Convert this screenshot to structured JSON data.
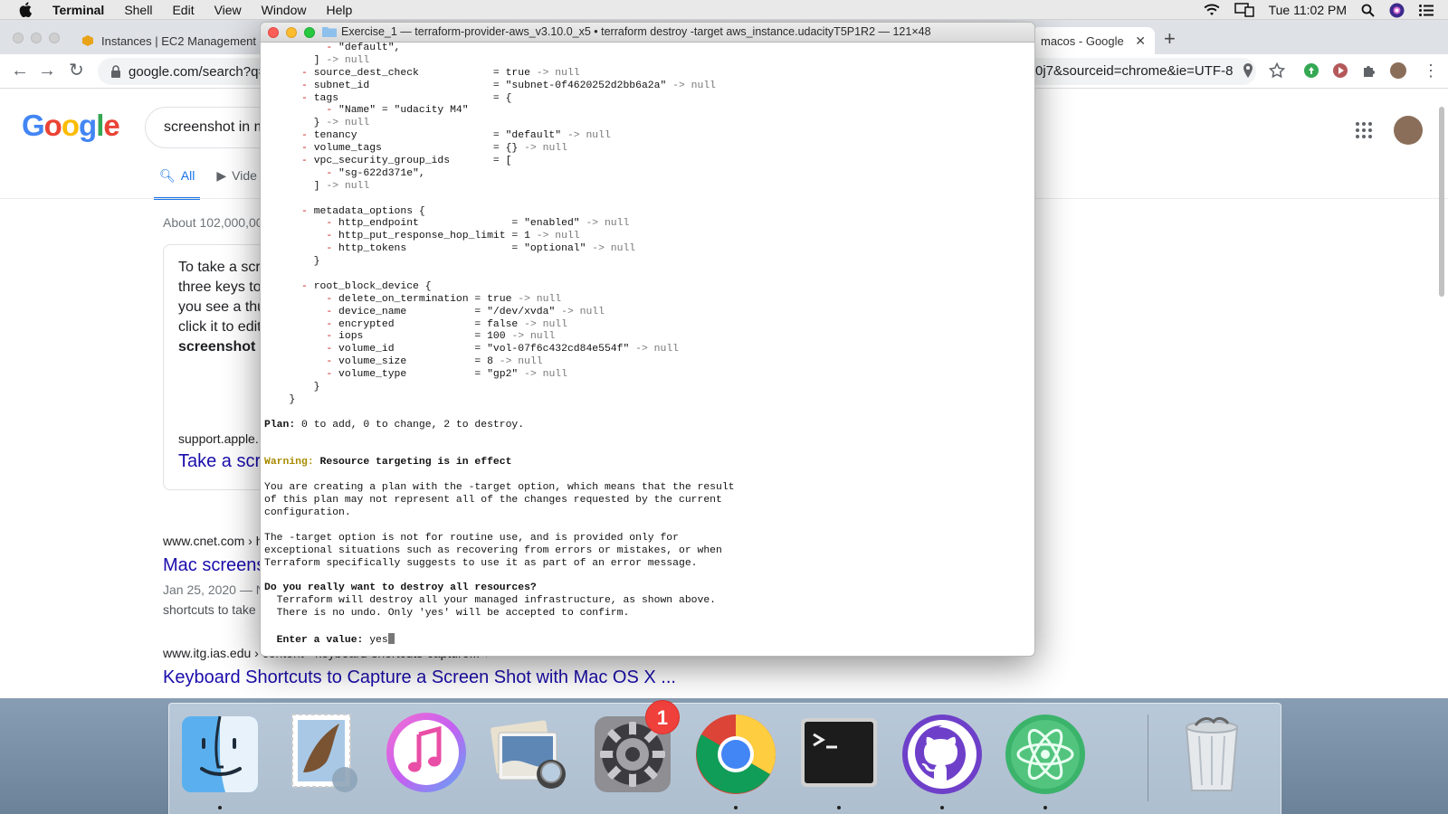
{
  "menubar": {
    "app_name": "Terminal",
    "items": [
      "Shell",
      "Edit",
      "View",
      "Window",
      "Help"
    ],
    "clock": "Tue 11:02 PM"
  },
  "chrome": {
    "tabs": [
      {
        "title": "Instances | EC2 Management"
      },
      {
        "title": "macos - Google"
      }
    ],
    "url": "google.com/search?q=",
    "url_tail": "0j7&sourceid=chrome&ie=UTF-8"
  },
  "google": {
    "logo": "Google",
    "query": "screenshot in m",
    "tabs": [
      "All",
      "Vide"
    ],
    "stats": "About 102,000,00",
    "snippet_lines": [
      "To take a scr",
      "three keys to",
      "you see a thu",
      "click it to edit",
      "screenshot"
    ],
    "snippet_source": "support.apple.",
    "snippet_link": "Take a scr",
    "result1_url": "www.cnet.com › h",
    "result1_title": "Mac screens",
    "result1_date": "Jan 25, 2020 — N",
    "result1_desc": "shortcuts to take",
    "result2_url": "www.itg.ias.edu › content › keyboard-shortcuts-capture... ▾",
    "result2_title": "Keyboard Shortcuts to Capture a Screen Shot with Mac OS X ..."
  },
  "terminal": {
    "title": "Exercise_1 — terraform-provider-aws_v3.10.0_x5 • terraform destroy -target aws_instance.udacityT5P1R2 — 121×48",
    "lines": [
      [
        {
          "t": "          - ",
          "c": "minus"
        },
        {
          "t": "\"default\","
        }
      ],
      [
        {
          "t": "        ] "
        },
        {
          "t": "-> null",
          "c": "arrow"
        }
      ],
      [
        {
          "t": "      - ",
          "c": "minus"
        },
        {
          "t": "source_dest_check            = true "
        },
        {
          "t": "-> null",
          "c": "arrow"
        }
      ],
      [
        {
          "t": "      - ",
          "c": "minus"
        },
        {
          "t": "subnet_id                    = \"subnet-0f4620252d2bb6a2a\" "
        },
        {
          "t": "-> null",
          "c": "arrow"
        }
      ],
      [
        {
          "t": "      - ",
          "c": "minus"
        },
        {
          "t": "tags                         = {"
        }
      ],
      [
        {
          "t": "          - ",
          "c": "minus"
        },
        {
          "t": "\"Name\" = \"udacity M4\""
        }
      ],
      [
        {
          "t": "        } "
        },
        {
          "t": "-> null",
          "c": "arrow"
        }
      ],
      [
        {
          "t": "      - ",
          "c": "minus"
        },
        {
          "t": "tenancy                      = \"default\" "
        },
        {
          "t": "-> null",
          "c": "arrow"
        }
      ],
      [
        {
          "t": "      - ",
          "c": "minus"
        },
        {
          "t": "volume_tags                  = {} "
        },
        {
          "t": "-> null",
          "c": "arrow"
        }
      ],
      [
        {
          "t": "      - ",
          "c": "minus"
        },
        {
          "t": "vpc_security_group_ids       = ["
        }
      ],
      [
        {
          "t": "          - ",
          "c": "minus"
        },
        {
          "t": "\"sg-622d371e\","
        }
      ],
      [
        {
          "t": "        ] "
        },
        {
          "t": "-> null",
          "c": "arrow"
        }
      ],
      [
        {
          "t": ""
        }
      ],
      [
        {
          "t": "      - ",
          "c": "minus"
        },
        {
          "t": "metadata_options {"
        }
      ],
      [
        {
          "t": "          - ",
          "c": "minus"
        },
        {
          "t": "http_endpoint               = \"enabled\" "
        },
        {
          "t": "-> null",
          "c": "arrow"
        }
      ],
      [
        {
          "t": "          - ",
          "c": "minus"
        },
        {
          "t": "http_put_response_hop_limit = 1 "
        },
        {
          "t": "-> null",
          "c": "arrow"
        }
      ],
      [
        {
          "t": "          - ",
          "c": "minus"
        },
        {
          "t": "http_tokens                 = \"optional\" "
        },
        {
          "t": "-> null",
          "c": "arrow"
        }
      ],
      [
        {
          "t": "        }"
        }
      ],
      [
        {
          "t": ""
        }
      ],
      [
        {
          "t": "      - ",
          "c": "minus"
        },
        {
          "t": "root_block_device {"
        }
      ],
      [
        {
          "t": "          - ",
          "c": "minus"
        },
        {
          "t": "delete_on_termination = true "
        },
        {
          "t": "-> null",
          "c": "arrow"
        }
      ],
      [
        {
          "t": "          - ",
          "c": "minus"
        },
        {
          "t": "device_name           = \"/dev/xvda\" "
        },
        {
          "t": "-> null",
          "c": "arrow"
        }
      ],
      [
        {
          "t": "          - ",
          "c": "minus"
        },
        {
          "t": "encrypted             = false "
        },
        {
          "t": "-> null",
          "c": "arrow"
        }
      ],
      [
        {
          "t": "          - ",
          "c": "minus"
        },
        {
          "t": "iops                  = 100 "
        },
        {
          "t": "-> null",
          "c": "arrow"
        }
      ],
      [
        {
          "t": "          - ",
          "c": "minus"
        },
        {
          "t": "volume_id             = \"vol-07f6c432cd84e554f\" "
        },
        {
          "t": "-> null",
          "c": "arrow"
        }
      ],
      [
        {
          "t": "          - ",
          "c": "minus"
        },
        {
          "t": "volume_size           = 8 "
        },
        {
          "t": "-> null",
          "c": "arrow"
        }
      ],
      [
        {
          "t": "          - ",
          "c": "minus"
        },
        {
          "t": "volume_type           = \"gp2\" "
        },
        {
          "t": "-> null",
          "c": "arrow"
        }
      ],
      [
        {
          "t": "        }"
        }
      ],
      [
        {
          "t": "    }"
        }
      ],
      [
        {
          "t": ""
        }
      ],
      [
        {
          "t": "Plan:",
          "c": "bold"
        },
        {
          "t": " 0 to add, 0 to change, 2 to destroy."
        }
      ],
      [
        {
          "t": ""
        }
      ],
      [
        {
          "t": ""
        }
      ],
      [
        {
          "t": "Warning:",
          "c": "warn"
        },
        {
          "t": " Resource targeting is in effect",
          "c": "bold"
        }
      ],
      [
        {
          "t": ""
        }
      ],
      [
        {
          "t": "You are creating a plan with the -target option, which means that the result"
        }
      ],
      [
        {
          "t": "of this plan may not represent all of the changes requested by the current"
        }
      ],
      [
        {
          "t": "configuration."
        }
      ],
      [
        {
          "t": ""
        }
      ],
      [
        {
          "t": "The -target option is not for routine use, and is provided only for"
        }
      ],
      [
        {
          "t": "exceptional situations such as recovering from errors or mistakes, or when"
        }
      ],
      [
        {
          "t": "Terraform specifically suggests to use it as part of an error message."
        }
      ],
      [
        {
          "t": ""
        }
      ],
      [
        {
          "t": "Do you really want to destroy all resources?",
          "c": "bold"
        }
      ],
      [
        {
          "t": "  Terraform will destroy all your managed infrastructure, as shown above."
        }
      ],
      [
        {
          "t": "  There is no undo. Only 'yes' will be accepted to confirm."
        }
      ],
      [
        {
          "t": ""
        }
      ],
      [
        {
          "t": "  Enter a value:",
          "c": "bold"
        },
        {
          "t": " yes"
        },
        {
          "t": "",
          "c": "cursor"
        }
      ]
    ]
  },
  "dock": {
    "apps": [
      {
        "name": "finder",
        "running": true
      },
      {
        "name": "mail",
        "running": false
      },
      {
        "name": "itunes",
        "running": false
      },
      {
        "name": "preview",
        "running": false
      },
      {
        "name": "system-preferences",
        "running": false,
        "badge": "1"
      },
      {
        "name": "chrome",
        "running": true
      },
      {
        "name": "terminal",
        "running": true
      },
      {
        "name": "github-desktop",
        "running": true
      },
      {
        "name": "atom",
        "running": true
      }
    ],
    "trash": "trash"
  },
  "colors": {
    "terminal_minus": "#c41a16",
    "terminal_warning": "#a88b00",
    "google_link": "#1a0dab",
    "google_blue": "#1a73e8",
    "badge_red": "#f0403b"
  }
}
